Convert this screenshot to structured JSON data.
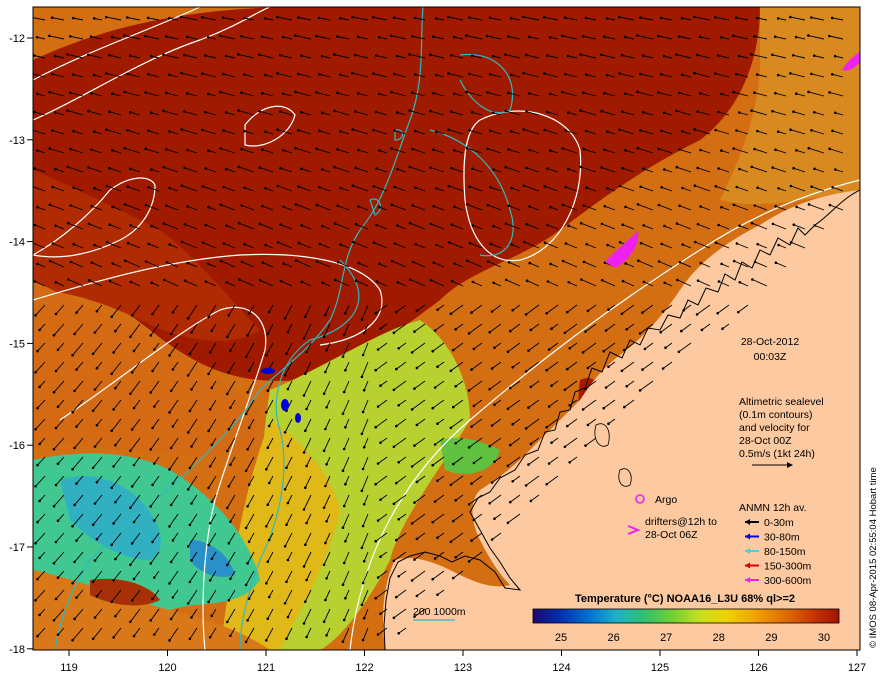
{
  "map": {
    "date": "28-Oct-2012",
    "time": "00:03Z",
    "altimetry_text": [
      "Altimetric sealevel",
      "(0.1m contours)",
      "and velocity for",
      "28-Oct 00Z",
      "0.5m/s (1kt 24h)"
    ],
    "argo_label": "Argo",
    "drifters_label": [
      "drifters@12h to",
      "28-Oct 06Z"
    ],
    "anmn": {
      "title": "ANMN 12h av.",
      "items": [
        {
          "label": "0-30m",
          "color": "#000000"
        },
        {
          "label": "30-80m",
          "color": "#0000dd"
        },
        {
          "label": "80-150m",
          "color": "#33dddd"
        },
        {
          "label": "150-300m",
          "color": "#dd0000"
        },
        {
          "label": "300-600m",
          "color": "#ee22ee"
        }
      ]
    },
    "bathy_label": "200  1000m",
    "colorbar": {
      "title": "Temperature (°C) NOAA16_L3U 68% ql>=2",
      "ticks": [
        "25",
        "26",
        "27",
        "28",
        "29",
        "30"
      ],
      "colors": [
        "#1a0a6e",
        "#0030b0",
        "#0070d0",
        "#20b0c8",
        "#30c070",
        "#70d030",
        "#c8e020",
        "#f0d000",
        "#f0a000",
        "#e07000",
        "#c83800",
        "#a01400"
      ]
    },
    "x_ticks": [
      "119",
      "120",
      "121",
      "122",
      "123",
      "124",
      "125",
      "126",
      "127"
    ],
    "y_ticks": [
      "-12",
      "-13",
      "-14",
      "-15",
      "-16",
      "-17",
      "-18"
    ],
    "credit": "© IMOS 08-Apr-2015 02:55:04 Hobart time",
    "colors": {
      "land": "#fcc9a0",
      "sst_warm": "#a01a00",
      "sst_mid": "#d06a10",
      "sst_cool": "#e0a020",
      "sst_green": "#a8d838",
      "sst_cold": "#30c0b0",
      "contour": "#ffffff",
      "bathy": "#30b8c0"
    }
  }
}
